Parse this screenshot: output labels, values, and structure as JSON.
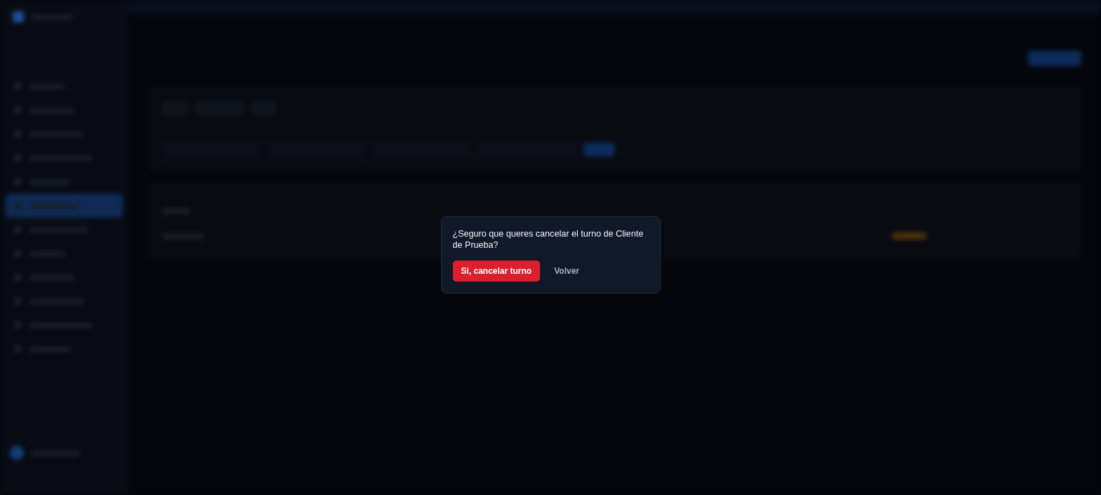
{
  "dialog": {
    "message": "¿Seguro que queres cancelar el turno de Cliente de Prueba?",
    "buttons": [
      {
        "label": "Si, cancelar turno",
        "kind": "danger"
      },
      {
        "label": "Volver",
        "kind": "plain"
      }
    ]
  }
}
